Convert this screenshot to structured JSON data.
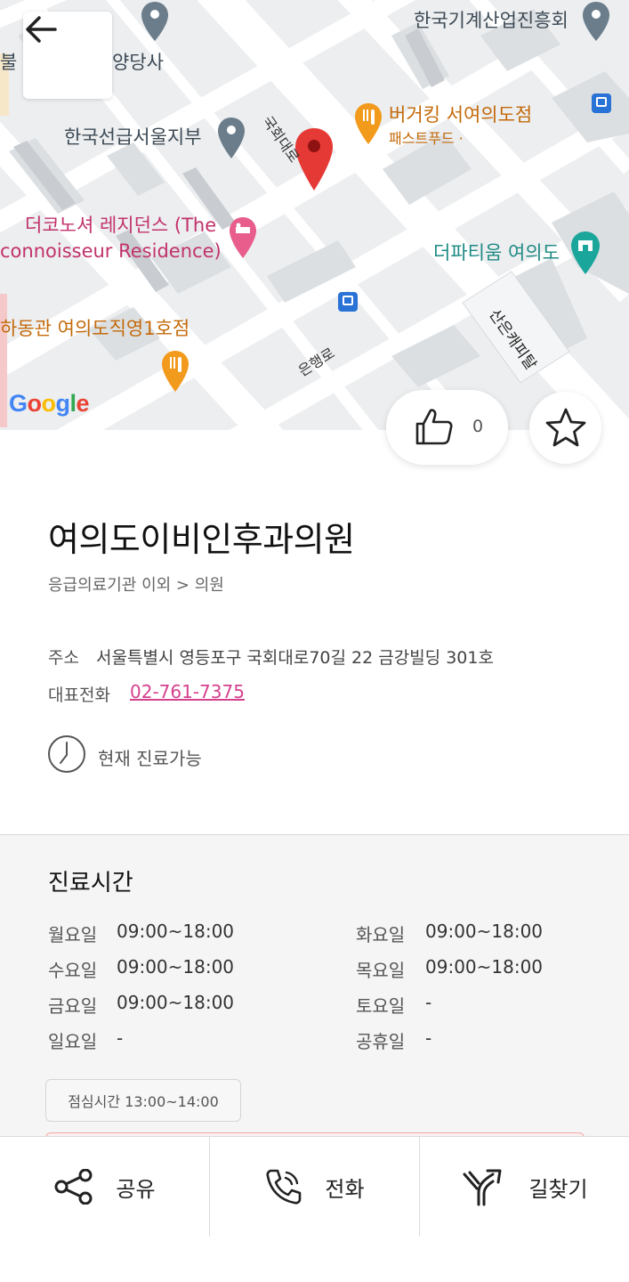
{
  "map": {
    "labels": {
      "korea_machinery": "한국기계산업진흥회",
      "yangdang": "양당사",
      "partial_left": "불",
      "burger_king": "버거킹 서여의도점",
      "burger_king_sub": "패스트푸드 ·",
      "korean_register": "한국선급서울지부",
      "connoisseur_1": "더코노셔 레지던스 (The",
      "connoisseur_2": "connoisseur Residence)",
      "partium": "더파티움 여의도",
      "hadongkwan": "하동관 여의도직영1호점",
      "road_gukhoe": "국회대로",
      "road_eunhaeng": "은행로",
      "sancom": "산은캐피탈"
    },
    "logo": "Google"
  },
  "actions": {
    "like_count": "0"
  },
  "place": {
    "name": "여의도이비인후과의원",
    "category": "응급의료기관 이외 > 의원",
    "address_label": "주소",
    "address": "서울특별시 영등포구 국회대로70길 22 금강빌딩 301호",
    "phone_label": "대표전화",
    "phone": "02-761-7375",
    "status": "현재 진료가능"
  },
  "hours": {
    "title": "진료시간",
    "days": [
      {
        "day": "월요일",
        "time": "09:00~18:00"
      },
      {
        "day": "화요일",
        "time": "09:00~18:00"
      },
      {
        "day": "수요일",
        "time": "09:00~18:00"
      },
      {
        "day": "목요일",
        "time": "09:00~18:00"
      },
      {
        "day": "금요일",
        "time": "09:00~18:00"
      },
      {
        "day": "토요일",
        "time": "-"
      },
      {
        "day": "일요일",
        "time": "-"
      },
      {
        "day": "공휴일",
        "time": "-"
      }
    ],
    "lunch": "점심시간 13:00~14:00"
  },
  "bottom_bar": {
    "share": "공유",
    "call": "전화",
    "directions": "길찾기"
  },
  "colors": {
    "accent_pink": "#d4418e",
    "marker_red": "#e53935",
    "hours_bg": "#f5f5f5"
  }
}
